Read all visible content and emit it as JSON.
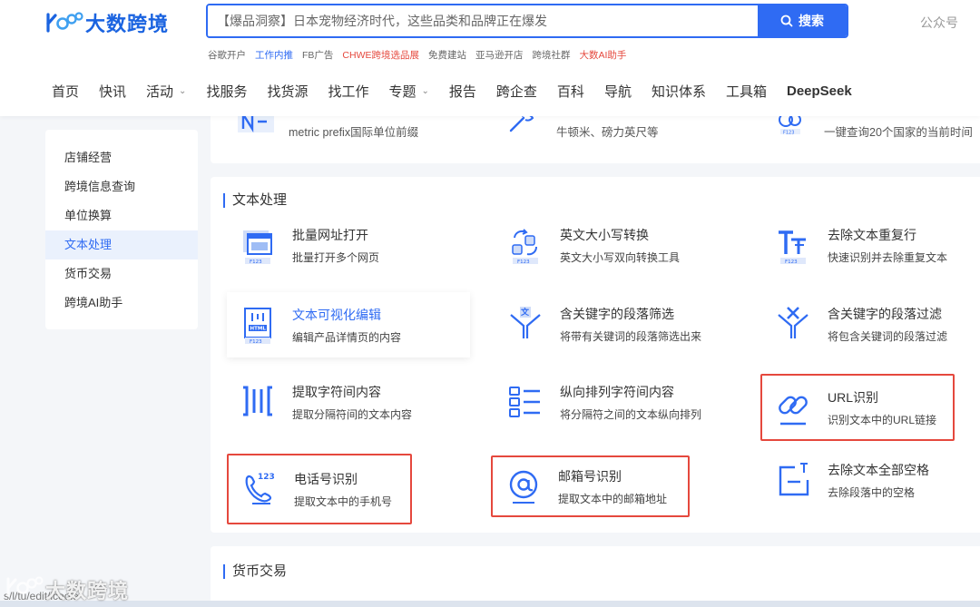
{
  "header": {
    "logo_text": "大数跨境",
    "search_placeholder": "【爆品洞察】日本宠物经济时代，这些品类和品牌正在爆发",
    "search_button": "搜索",
    "gongzhonghao": "公众号",
    "hotlinks": [
      "谷歌开户",
      "工作内推",
      "FB广告",
      "CHWE跨境选品展",
      "免费建站",
      "亚马逊开店",
      "跨境社群",
      "大数AI助手"
    ],
    "hotlink_colors": [
      "#666666",
      "#2f6bf3",
      "#666666",
      "#e5483d",
      "#666666",
      "#666666",
      "#666666",
      "#e5483d"
    ]
  },
  "nav": [
    "首页",
    "快讯",
    "活动",
    "找服务",
    "找货源",
    "找工作",
    "专题",
    "报告",
    "跨企查",
    "百科",
    "导航",
    "知识体系",
    "工具箱",
    "DeepSeek"
  ],
  "sidebar": {
    "items": [
      "店铺经营",
      "跨境信息查询",
      "单位换算",
      "文本处理",
      "货币交易",
      "跨境AI助手"
    ],
    "active": "文本处理"
  },
  "partial_tools": [
    {
      "desc": "metric prefix国际单位前缀"
    },
    {
      "desc": "牛顿米、磅力英尺等"
    },
    {
      "desc": "一键查询20个国家的当前时间"
    }
  ],
  "text_section": {
    "title": "文本处理",
    "tools": [
      {
        "name": "批量网址打开",
        "desc": "批量打开多个网页",
        "icon": "browser-window-icon"
      },
      {
        "name": "英文大小写转换",
        "desc": "英文大小写双向转换工具",
        "icon": "case-convert-icon"
      },
      {
        "name": "去除文本重复行",
        "desc": "快速识别并去除重复文本",
        "icon": "dedupe-lines-icon"
      },
      {
        "name": "文本可视化编辑",
        "desc": "编辑产品详情页的内容",
        "icon": "html-editor-icon"
      },
      {
        "name": "含关键字的段落筛选",
        "desc": "将带有关键词的段落筛选出来",
        "icon": "filter-translate-icon"
      },
      {
        "name": "含关键字的段落过滤",
        "desc": "将包含关键词的段落过滤",
        "icon": "filter-remove-icon"
      },
      {
        "name": "提取字符间内容",
        "desc": "提取分隔符间的文本内容",
        "icon": "brackets-icon"
      },
      {
        "name": "纵向排列字符间内容",
        "desc": "将分隔符之间的文本纵向排列",
        "icon": "list-icon"
      },
      {
        "name": "URL识别",
        "desc": "识别文本中的URL链接",
        "icon": "link-icon"
      },
      {
        "name": "电话号识别",
        "desc": "提取文本中的手机号",
        "icon": "phone-icon"
      },
      {
        "name": "邮箱号识别",
        "desc": "提取文本中的邮箱地址",
        "icon": "email-at-icon"
      },
      {
        "name": "去除文本全部空格",
        "desc": "去除段落中的空格",
        "icon": "remove-space-icon"
      }
    ]
  },
  "currency_section": {
    "title": "货币交易"
  },
  "watermark": {
    "url": "s/l/tu/edit/icoole",
    "text": "大数跨境"
  },
  "colors": {
    "accent": "#2f6bf3",
    "highlight": "#e5483d",
    "icon_blue": "#2f6bf3"
  }
}
